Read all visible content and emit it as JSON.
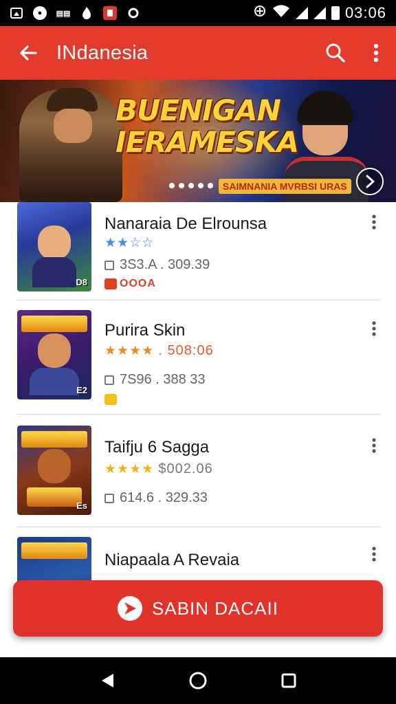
{
  "status_bar": {
    "time": "03:06",
    "left_icons": [
      "dark-mode-icon",
      "app-shield-icon",
      "reader-icon",
      "fire-icon",
      "red-square-icon",
      "settings-dot-icon"
    ],
    "right_icons": [
      "data-saver-icon",
      "wifi-icon",
      "signal-icon",
      "signal-icon",
      "battery-icon"
    ]
  },
  "app_bar": {
    "title": "INdanesia",
    "back_icon": "arrow-back-icon",
    "search_icon": "search-icon",
    "more_icon": "more-vert-icon",
    "color": "#e33a2e"
  },
  "banner": {
    "title_line1": "BUENIGAN",
    "title_line2": "IERAMESKA",
    "subtitle": "SAIMNANIA MVRBSI URAS",
    "dot_count": 5,
    "next_icon": "chevron-right-icon"
  },
  "apps": [
    {
      "name": "Nanaraia De Elrounsa",
      "rating_stars": "★★☆☆",
      "price": "",
      "size": "3S3.A . 309.39",
      "tag": "OOOA",
      "thumb_label": "D8"
    },
    {
      "name": "Purira Skin",
      "rating_stars": "★★★★",
      "price": ". 508:06",
      "size": "7S96 . 388 33",
      "tag": "",
      "thumb_label": "E2"
    },
    {
      "name": "Taifju 6 Sagga",
      "rating_stars": "★★★★",
      "price": "$002.06",
      "size": "614.6 . 329.33",
      "tag": "",
      "thumb_label": "Es"
    },
    {
      "name": "Niapaala A Revaia",
      "rating_stars": "",
      "price": "",
      "size": "",
      "tag": "",
      "thumb_label": ""
    }
  ],
  "fab": {
    "label": "SABIN DACAII",
    "icon": "play-icon",
    "color": "#e1332c"
  },
  "nav_bar": {
    "back_icon": "nav-back-icon",
    "home_icon": "nav-home-icon",
    "recents_icon": "nav-recents-icon"
  }
}
